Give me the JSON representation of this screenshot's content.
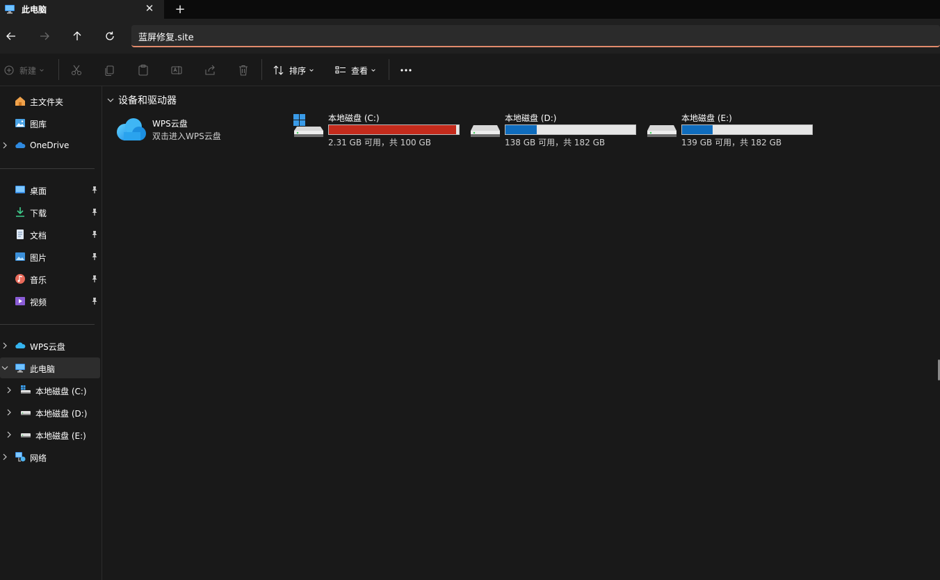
{
  "tab": {
    "title": "此电脑",
    "icon": "computer-icon",
    "close_glyph": "✕",
    "new_tab_glyph": "+"
  },
  "address": {
    "value": "蓝屏修复.site"
  },
  "nav": {
    "back_icon": "back-arrow-icon",
    "forward_icon": "forward-arrow-icon",
    "up_icon": "up-arrow-icon",
    "refresh_icon": "refresh-icon"
  },
  "toolbar": {
    "new_label": "新建",
    "sort_label": "排序",
    "view_label": "查看",
    "more_glyph": "•••"
  },
  "sidebar": {
    "top_items": [
      {
        "label": "主文件夹",
        "icon": "home-icon"
      },
      {
        "label": "图库",
        "icon": "gallery-icon"
      },
      {
        "label": "OneDrive",
        "icon": "onedrive-cloud-icon"
      }
    ],
    "quick_access": [
      {
        "label": "桌面",
        "icon": "desktop-icon"
      },
      {
        "label": "下载",
        "icon": "download-icon"
      },
      {
        "label": "文档",
        "icon": "documents-icon"
      },
      {
        "label": "图片",
        "icon": "pictures-icon"
      },
      {
        "label": "音乐",
        "icon": "music-icon"
      },
      {
        "label": "视频",
        "icon": "videos-icon"
      }
    ],
    "tree": [
      {
        "label": "WPS云盘",
        "icon": "wps-cloud-icon"
      },
      {
        "label": "此电脑",
        "icon": "computer-icon",
        "selected": true
      },
      {
        "label": "本地磁盘 (C:)",
        "icon": "windows-drive-icon"
      },
      {
        "label": "本地磁盘 (D:)",
        "icon": "drive-icon"
      },
      {
        "label": "本地磁盘 (E:)",
        "icon": "drive-icon"
      },
      {
        "label": "网络",
        "icon": "network-icon"
      }
    ]
  },
  "content": {
    "group_title": "设备和驱动器",
    "cloud": {
      "title": "WPS云盘",
      "subtitle": "双击进入WPS云盘"
    },
    "drives": [
      {
        "name": "本地磁盘 (C:)",
        "free_text": "2.31 GB 可用，共 100 GB",
        "used_fraction": 0.977,
        "bar_color": "#c42b1c",
        "windows": true
      },
      {
        "name": "本地磁盘 (D:)",
        "free_text": "138 GB 可用，共 182 GB",
        "used_fraction": 0.242,
        "bar_color": "#0f6cbd",
        "windows": false
      },
      {
        "name": "本地磁盘 (E:)",
        "free_text": "139 GB 可用，共 182 GB",
        "used_fraction": 0.236,
        "bar_color": "#0f6cbd",
        "windows": false
      }
    ]
  },
  "colors": {
    "background": "#191919",
    "accent_address": "#e28b6c",
    "drive_full": "#c42b1c",
    "drive_normal": "#0f6cbd"
  }
}
